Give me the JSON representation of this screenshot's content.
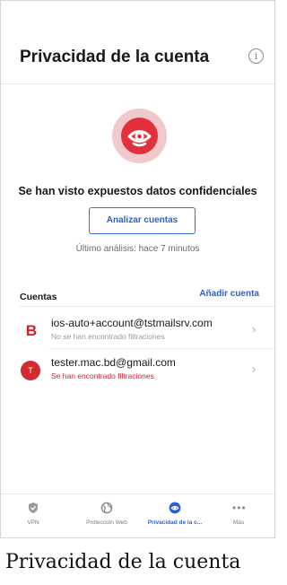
{
  "header": {
    "title": "Privacidad de la cuenta",
    "info_icon": "info-icon"
  },
  "hero": {
    "icon": "eye-privacy-icon",
    "accent_color": "#e2313c",
    "halo_color": "#f1c9cc"
  },
  "status": {
    "title": "Se han visto expuestos datos confidenciales",
    "scan_button_label": "Analizar cuentas",
    "last_scan": "Último análisis: hace 7 minutos"
  },
  "accounts": {
    "heading": "Cuentas",
    "add_label": "Añadir cuenta",
    "items": [
      {
        "avatar": "B",
        "email": "ios-auto+account@tstmailsrv.com",
        "status": "No se han encontrado filtraciones",
        "status_color": "#9a9a9a"
      },
      {
        "avatar": "T",
        "email": "tester.mac.bd@gmail.com",
        "status": "Se han encontrado filtraciones",
        "status_color": "#d11f2a"
      }
    ]
  },
  "tabbar": {
    "items": [
      {
        "label": "VPN",
        "icon": "shield-check-icon",
        "active": false
      },
      {
        "label": "Protección Web",
        "icon": "globe-icon",
        "active": false
      },
      {
        "label": "Privacidad de la c...",
        "icon": "eye-privacy-icon",
        "active": true
      },
      {
        "label": "Más",
        "icon": "more-dots-icon",
        "active": false
      }
    ],
    "active_color": "#2a5fd6"
  },
  "caption": "Privacidad de la cuenta"
}
